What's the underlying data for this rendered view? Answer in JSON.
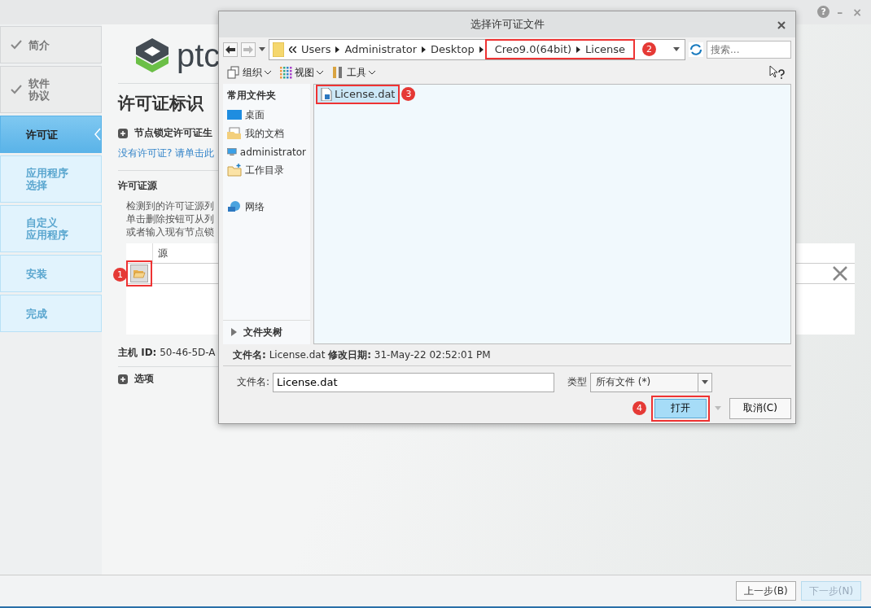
{
  "window": {
    "controls": [
      "?",
      "–",
      "×"
    ]
  },
  "sidebar": {
    "items": [
      {
        "lines": [
          "简介"
        ],
        "kind": "done",
        "selected": false
      },
      {
        "lines": [
          "软件",
          "协议"
        ],
        "kind": "done",
        "selected": false
      },
      {
        "lines": [
          "许可证"
        ],
        "kind": "current",
        "selected": true
      },
      {
        "lines": [
          "应用程序",
          "选择"
        ],
        "kind": "pending",
        "selected": false
      },
      {
        "lines": [
          "自定义",
          "应用程序"
        ],
        "kind": "pending",
        "selected": false
      },
      {
        "lines": [
          "安装"
        ],
        "kind": "pending",
        "selected": false
      },
      {
        "lines": [
          "完成"
        ],
        "kind": "pending",
        "selected": false
      }
    ]
  },
  "main": {
    "logo_text": "ptc",
    "heading": "许可证标识",
    "node_locked": "节点锁定许可证生",
    "no_license_link": "没有许可证? 请单击此",
    "source_heading": "许可证源",
    "description": [
      "检测到的许可证源列",
      "单击删除按钮可从列",
      "或者输入现有节点锁"
    ],
    "table": {
      "columns": [
        "源"
      ],
      "callout": "1"
    },
    "host_id": "**主机 ID:** 50-46-5D-A",
    "options": "选项"
  },
  "dialog": {
    "title": "选择许可证文件",
    "address": {
      "crumbs": [
        {
          "label": "Users",
          "boxed": false
        },
        {
          "label": "Administrator",
          "boxed": false
        },
        {
          "label": "Desktop",
          "boxed": false
        },
        {
          "label": "Creo9.0(64bit)",
          "boxed": true
        },
        {
          "label": "License",
          "boxed": true
        }
      ],
      "callout": "2"
    },
    "search": {
      "placeholder": "搜索..."
    },
    "toolbar": [
      "组织",
      "视图",
      "工具"
    ],
    "nav": {
      "header": "常用文件夹",
      "items": [
        {
          "label": "桌面",
          "kind": "desktop"
        },
        {
          "label": "我的文档",
          "kind": "documents"
        },
        {
          "label": "administrator",
          "kind": "computer"
        },
        {
          "label": "工作目录",
          "kind": "newfolder"
        },
        {
          "label": "网络",
          "kind": "network"
        }
      ],
      "tree": "文件夹树"
    },
    "files": [
      {
        "name": "License.dat",
        "selected": true,
        "callout": "3"
      }
    ],
    "info": "**文件名:** License.dat  **修改日期:** 31-May-22 02:52:01 PM",
    "filename": {
      "label": "文件名:",
      "value": "License.dat"
    },
    "type": {
      "label": "类型",
      "value": "所有文件 (*)"
    },
    "open": {
      "label": "打开",
      "callout": "4"
    },
    "cancel": "取消(C)"
  },
  "footer": {
    "buttons": [
      {
        "label": "上一步(B)",
        "disabled": false
      },
      {
        "label": "下一步(N)",
        "disabled": true
      }
    ]
  }
}
